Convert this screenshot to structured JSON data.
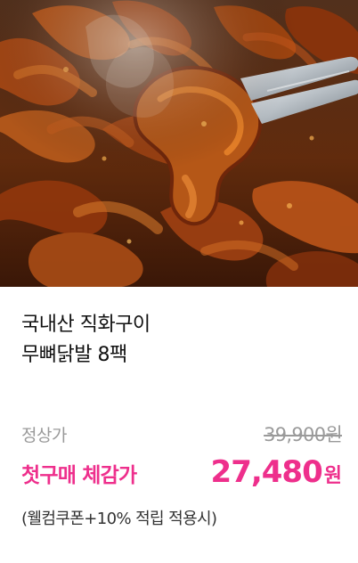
{
  "product": {
    "image_alt": "food-photo",
    "title_line1": "국내산 직화구이",
    "title_line2": "무뼈닭발 8팩",
    "regular_label": "정상가",
    "regular_price": "39,900원",
    "deal_label": "첫구매 체감가",
    "deal_price": "27,480",
    "deal_unit": "원",
    "note": "(웰컴쿠폰+10% 적립 적용시)"
  },
  "colors": {
    "accent": "#ee2f8c",
    "muted": "#9a9a9a",
    "title": "#111111",
    "note": "#333333"
  }
}
